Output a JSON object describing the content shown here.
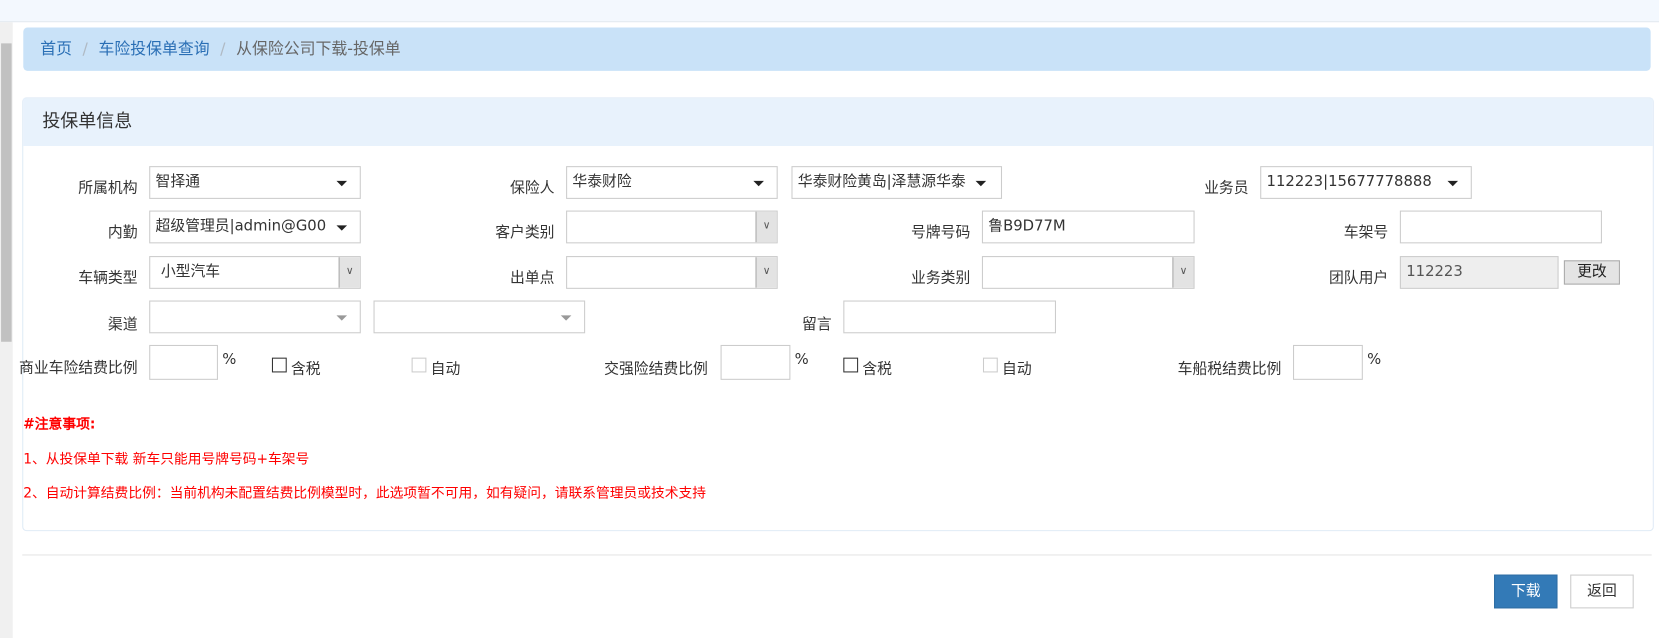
{
  "breadcrumb": {
    "home": "首页",
    "list": "车险投保单查询",
    "current": "从保险公司下载-投保单",
    "sep": "/"
  },
  "panel": {
    "title": "投保单信息"
  },
  "form": {
    "org": {
      "label": "所属机构",
      "value": "智择通"
    },
    "insurer": {
      "label": "保险人",
      "value": "华泰财险",
      "branch": "华泰财险黄岛|泽慧源华泰"
    },
    "salesman": {
      "label": "业务员",
      "value": "112223|15677778888"
    },
    "clerk": {
      "label": "内勤",
      "value": "超级管理员|admin@G00"
    },
    "customer_type": {
      "label": "客户类别",
      "value": ""
    },
    "plate": {
      "label": "号牌号码",
      "value": "鲁B9D77M"
    },
    "vin": {
      "label": "车架号",
      "value": ""
    },
    "vehicle_type": {
      "label": "车辆类型",
      "value": "小型汽车"
    },
    "issue_point": {
      "label": "出单点",
      "value": ""
    },
    "biz_type": {
      "label": "业务类别",
      "value": ""
    },
    "team_user": {
      "label": "团队用户",
      "value": "112223",
      "change_label": "更改"
    },
    "channel": {
      "label": "渠道",
      "value1": "",
      "value2": ""
    },
    "message": {
      "label": "留言",
      "value": ""
    },
    "commercial_rate": {
      "label": "商业车险结费比例",
      "value": "",
      "unit": "%",
      "tax_label": "含税",
      "auto_label": "自动"
    },
    "compulsory_rate": {
      "label": "交强险结费比例",
      "value": "",
      "unit": "%",
      "tax_label": "含税",
      "auto_label": "自动"
    },
    "vessel_tax_rate": {
      "label": "车船税结费比例",
      "value": "",
      "unit": "%"
    }
  },
  "notes": {
    "title": "#注意事项:",
    "items": [
      "1、从投保单下载 新车只能用号牌号码+车架号",
      "2、自动计算结费比例：当前机构未配置结费比例模型时，此选项暂不可用，如有疑问，请联系管理员或技术支持"
    ]
  },
  "actions": {
    "download": "下载",
    "back": "返回"
  }
}
